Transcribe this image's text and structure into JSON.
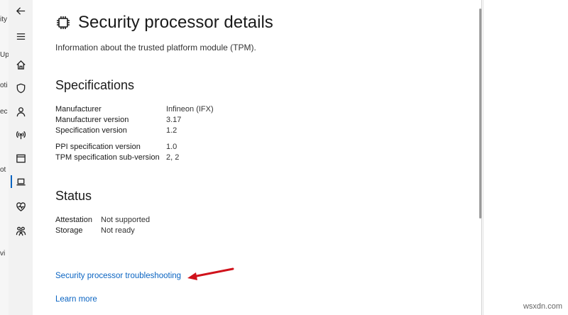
{
  "left_strip": {
    "fragments": [
      "ity",
      "Up",
      "oti",
      "ec",
      "ot",
      "vi"
    ]
  },
  "nav": {
    "items": [
      {
        "icon": "back-arrow-icon",
        "label": "Back"
      },
      {
        "icon": "hamburger-menu-icon",
        "label": "Menu"
      },
      {
        "icon": "home-icon",
        "label": "Home"
      },
      {
        "icon": "shield-icon",
        "label": "Virus & threat protection"
      },
      {
        "icon": "person-icon",
        "label": "Account protection"
      },
      {
        "icon": "wireless-antenna-icon",
        "label": "Firewall & network protection"
      },
      {
        "icon": "browser-window-icon",
        "label": "App & browser control"
      },
      {
        "icon": "laptop-icon",
        "label": "Device security"
      },
      {
        "icon": "heart-pulse-icon",
        "label": "Device performance & health"
      },
      {
        "icon": "family-icon",
        "label": "Family options"
      }
    ],
    "active_index": 7
  },
  "page": {
    "title": "Security processor details",
    "subtitle": "Information about the trusted platform module (TPM)."
  },
  "specifications": {
    "heading": "Specifications",
    "rows": [
      {
        "label": "Manufacturer",
        "value": "Infineon (IFX)"
      },
      {
        "label": "Manufacturer version",
        "value": "3.17"
      },
      {
        "label": "Specification version",
        "value": "1.2"
      },
      {
        "label": "PPI specification version",
        "value": "1.0"
      },
      {
        "label": "TPM specification sub-version",
        "value": "2, 2"
      }
    ]
  },
  "status": {
    "heading": "Status",
    "rows": [
      {
        "label": "Attestation",
        "value": "Not supported"
      },
      {
        "label": "Storage",
        "value": "Not ready"
      }
    ]
  },
  "links": {
    "troubleshooting": "Security processor troubleshooting",
    "learn_more": "Learn more"
  },
  "watermark": "wsxdn.com",
  "colors": {
    "accent": "#0a64c2",
    "annotation_arrow": "#d0121b",
    "nav_background": "#f2f2f2"
  }
}
